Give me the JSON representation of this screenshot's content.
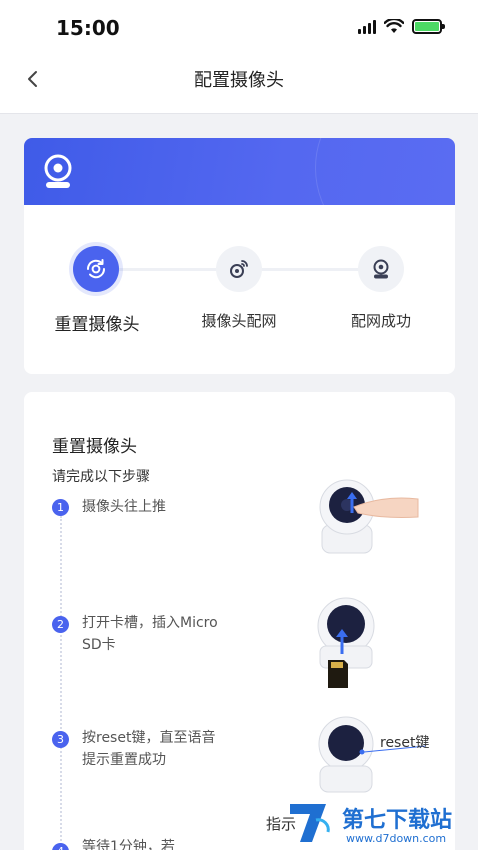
{
  "status_bar": {
    "time": "15:00"
  },
  "header": {
    "title": "配置摄像头",
    "back_icon": "chevron-left-icon"
  },
  "progress": {
    "steps": [
      {
        "label": "重置摄像头",
        "icon": "camera-reset-icon",
        "active": true
      },
      {
        "label": "摄像头配网",
        "icon": "camera-network-icon",
        "active": false
      },
      {
        "label": "配网成功",
        "icon": "camera-success-icon",
        "active": false
      }
    ]
  },
  "instructions": {
    "title": "重置摄像头",
    "subtitle": "请完成以下步骤",
    "steps": [
      {
        "number": "1",
        "text": "摄像头往上推"
      },
      {
        "number": "2",
        "text": "打开卡槽，插入Micro SD卡"
      },
      {
        "number": "3",
        "text": "按reset键，直至语音提示重置成功"
      },
      {
        "number": "4",
        "text": "等待1分钟，若"
      }
    ],
    "reset_label": "reset键",
    "partial_hint": "指示"
  },
  "watermark": {
    "name": "第七下载站",
    "url": "www.d7down.com"
  },
  "colors": {
    "accent": "#4a63ee",
    "banner": "#4f64f0",
    "background": "#f1f2f5"
  }
}
